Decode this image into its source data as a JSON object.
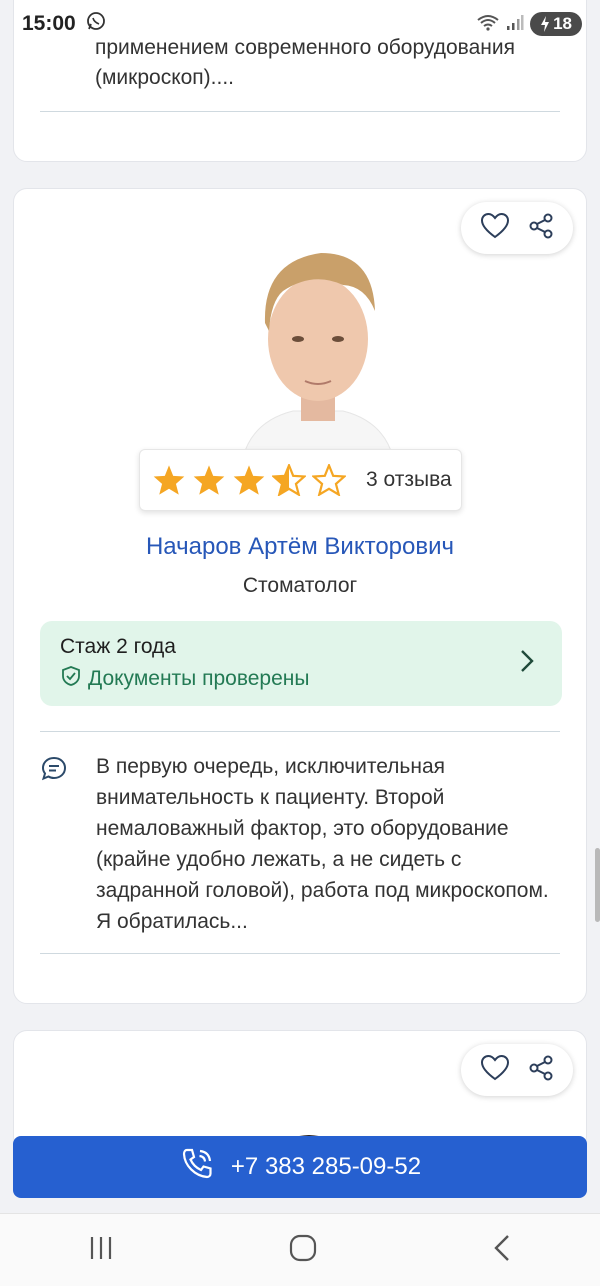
{
  "status_bar": {
    "time": "15:00",
    "battery": "18"
  },
  "previous_card": {
    "snippet": "применением современного оборудования (микроскоп)...."
  },
  "doctor": {
    "name": "Начаров Артём Викторович",
    "specialty": "Стоматолог",
    "rating": 3.5,
    "rating_max": 5,
    "reviews_label": "3 отзыва",
    "experience": "Стаж 2 года",
    "verified_label": "Документы проверены",
    "review_snippet": "В первую очередь, исключительная внимательность к пациенту. Второй немаловажный фактор, это оборудование (крайне удобно лежать, а не сидеть с задранной головой), работа под микроскопом. Я обратилась..."
  },
  "call": {
    "phone": "+7 383 285-09-52"
  },
  "colors": {
    "accent": "#2660d0",
    "name_link": "#2757b8",
    "star": "#f5a623",
    "verified_bg": "#e1f5ea",
    "verified_text": "#237a54"
  },
  "icons": [
    "whatsapp-icon",
    "wifi-icon",
    "signal-icon",
    "heart-icon",
    "share-icon",
    "star-icon",
    "shield-check-icon",
    "chevron-right-icon",
    "chat-icon",
    "phone-icon",
    "recent-apps-icon",
    "home-icon",
    "back-icon"
  ]
}
